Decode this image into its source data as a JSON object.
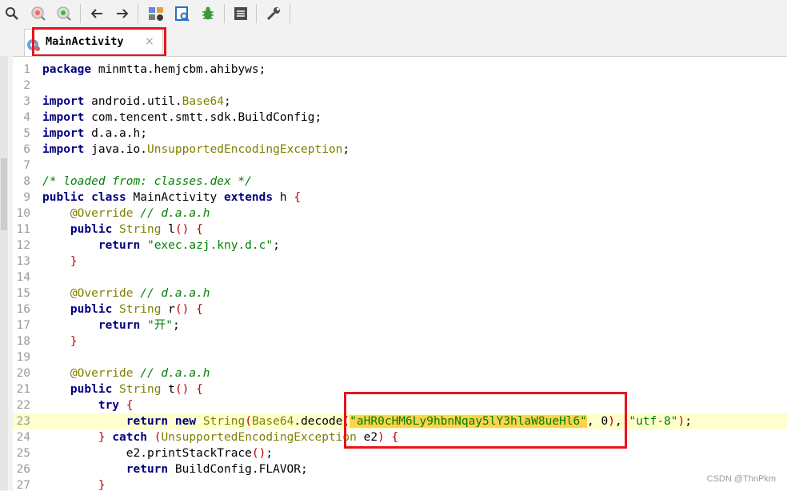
{
  "toolbar": {
    "icons": [
      "search-icon",
      "find-usages-icon",
      "find-refresh-icon",
      "back-icon",
      "forward-icon",
      "deobfuscation-icon",
      "decompile-icon",
      "debug-icon",
      "log-icon",
      "settings-icon"
    ]
  },
  "tab": {
    "title": "MainActivity",
    "close": "×"
  },
  "code": {
    "highlight_line": 23,
    "lines": [
      {
        "n": "1",
        "t": "package minmtta.hemjcbm.ahibyws;"
      },
      {
        "n": "2",
        "t": ""
      },
      {
        "n": "3",
        "t": "import android.util.Base64;"
      },
      {
        "n": "4",
        "t": "import com.tencent.smtt.sdk.BuildConfig;"
      },
      {
        "n": "5",
        "t": "import d.a.a.h;"
      },
      {
        "n": "6",
        "t": "import java.io.UnsupportedEncodingException;"
      },
      {
        "n": "7",
        "t": ""
      },
      {
        "n": "8",
        "t": "/* loaded from: classes.dex */"
      },
      {
        "n": "9",
        "t": "public class MainActivity extends h {"
      },
      {
        "n": "10",
        "t": "    @Override // d.a.a.h"
      },
      {
        "n": "11",
        "t": "    public String l() {"
      },
      {
        "n": "12",
        "t": "        return \"exec.azj.kny.d.c\";"
      },
      {
        "n": "13",
        "t": "    }"
      },
      {
        "n": "14",
        "t": ""
      },
      {
        "n": "15",
        "t": "    @Override // d.a.a.h"
      },
      {
        "n": "16",
        "t": "    public String r() {"
      },
      {
        "n": "17",
        "t": "        return \"开\";"
      },
      {
        "n": "18",
        "t": "    }"
      },
      {
        "n": "19",
        "t": ""
      },
      {
        "n": "20",
        "t": "    @Override // d.a.a.h"
      },
      {
        "n": "21",
        "t": "    public String t() {"
      },
      {
        "n": "22",
        "t": "        try {"
      },
      {
        "n": "23",
        "t": "            return new String(Base64.decode(\"aHR0cHM6Ly9hbnNqay5lY3hlaW8ueHl6\", 0), \"utf-8\");"
      },
      {
        "n": "24",
        "t": "        } catch (UnsupportedEncodingException e2) {"
      },
      {
        "n": "25",
        "t": "            e2.printStackTrace();"
      },
      {
        "n": "26",
        "t": "            return BuildConfig.FLAVOR;"
      },
      {
        "n": "27",
        "t": "        }"
      }
    ]
  },
  "watermark": "CSDN @ThnPkm",
  "colors": {
    "annotation_box": "#e8141a",
    "line_highlight": "#ffffcc",
    "selection": "#ffd24d"
  }
}
